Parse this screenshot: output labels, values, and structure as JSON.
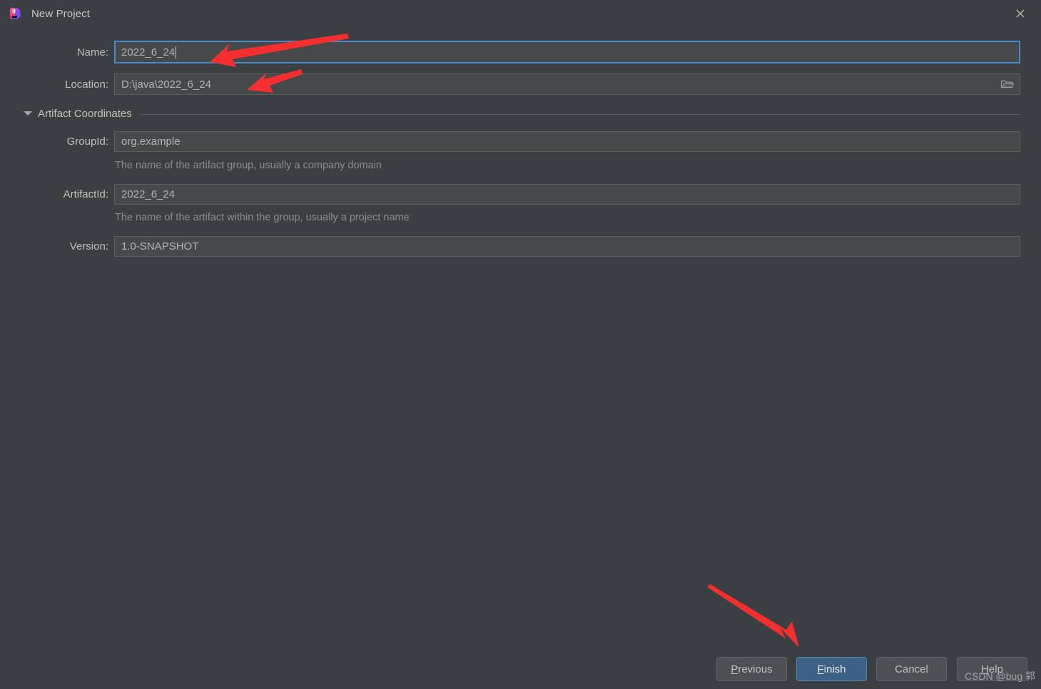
{
  "window": {
    "title": "New Project",
    "app_icon": "intellij-idea-icon",
    "close_icon": "close-icon",
    "background_color": "#3c3f41",
    "accent_color": "#4a88c7"
  },
  "form": {
    "name": {
      "label": "Name:",
      "value": "2022_6_24",
      "focused": true
    },
    "location": {
      "label": "Location:",
      "value": "D:\\java\\2022_6_24",
      "browse_icon": "folder-icon"
    }
  },
  "artifact_section": {
    "title": "Artifact Coordinates",
    "expanded": true,
    "collapse_icon": "chevron-down-icon",
    "fields": [
      {
        "label": "GroupId:",
        "value": "org.example",
        "hint": "The name of the artifact group, usually a company domain"
      },
      {
        "label": "ArtifactId:",
        "value": "2022_6_24",
        "hint": "The name of the artifact within the group, usually a project name"
      },
      {
        "label": "Version:",
        "value": "1.0-SNAPSHOT",
        "hint": ""
      }
    ]
  },
  "buttons": {
    "previous": {
      "label": "Previous",
      "mnemonic": "P",
      "primary": false
    },
    "finish": {
      "label": "Finish",
      "mnemonic": "F",
      "primary": true
    },
    "cancel": {
      "label": "Cancel",
      "mnemonic": "",
      "primary": false
    },
    "help": {
      "label": "Help",
      "mnemonic": "H",
      "primary": false
    }
  },
  "annotations": {
    "color": "#f52f2f",
    "arrows": [
      {
        "name": "arrow-to-name-field"
      },
      {
        "name": "arrow-to-location-field"
      },
      {
        "name": "arrow-to-finish-button"
      }
    ]
  },
  "watermark": {
    "text": "CSDN @bug 郭"
  }
}
